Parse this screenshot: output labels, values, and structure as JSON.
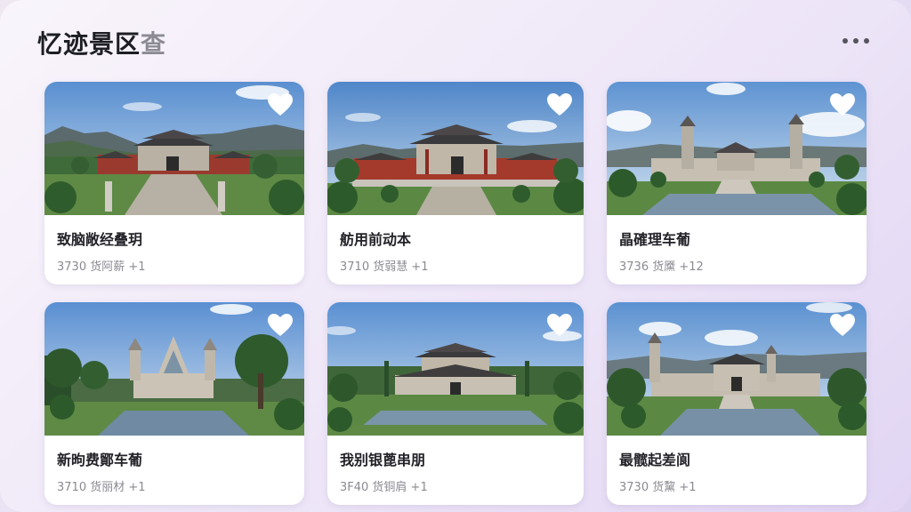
{
  "header": {
    "title": "忆迹景区",
    "title_faded": "查",
    "more_icon": "more-horizontal-icon"
  },
  "heart_icon": "heart-icon",
  "cards": [
    {
      "name": "致脑敞经叠玥",
      "meta": "3730 货阿薪 +1",
      "style": "palace-mountains"
    },
    {
      "name": "舫用前动本",
      "meta": "3710 货弱慧 +1",
      "style": "palace-courtyard"
    },
    {
      "name": "晶確理车葡",
      "meta": "3736 货黡 +12",
      "style": "towers-lake"
    },
    {
      "name": "新昫费鄮车葡",
      "meta": "3710 货丽材 +1",
      "style": "cathedral-pond"
    },
    {
      "name": "我别银蓖串朋",
      "meta": "3F40 货铜肩 +1",
      "style": "pavilion-pond"
    },
    {
      "name": "最髋起差阆",
      "meta": "3730 货黧 +1",
      "style": "palace-lake"
    }
  ]
}
